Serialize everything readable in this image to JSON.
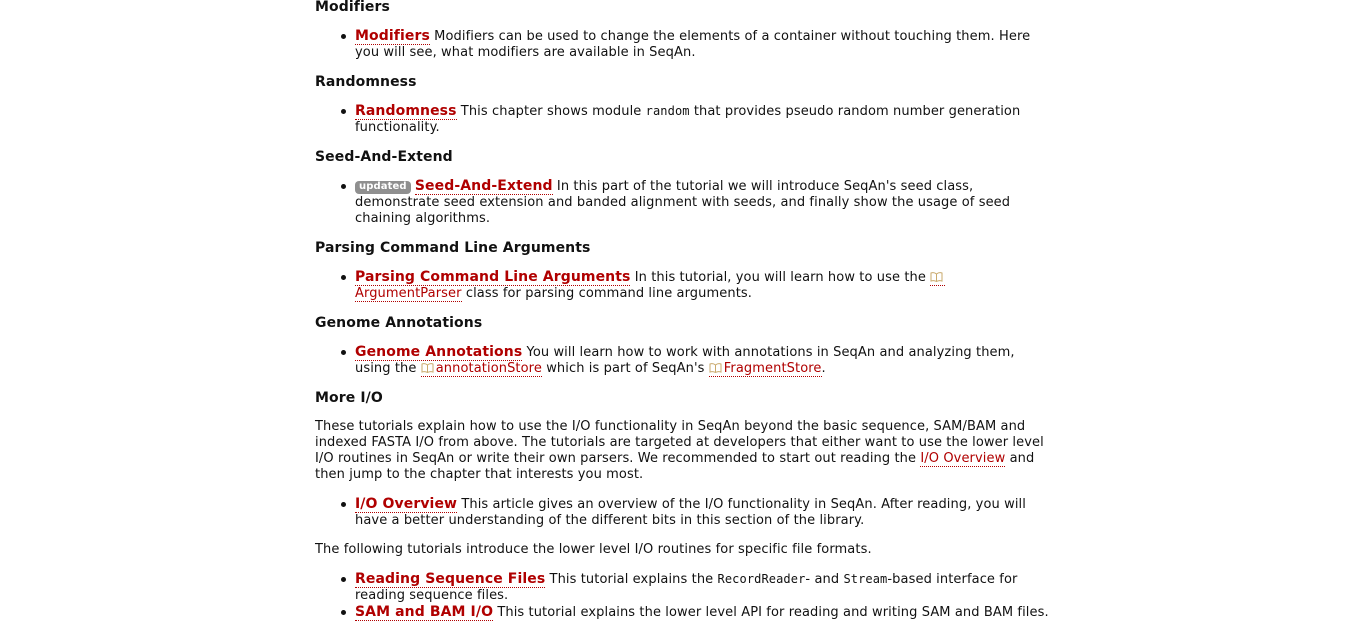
{
  "sections": {
    "modifiers": {
      "heading": "Modifiers",
      "link": "Modifiers",
      "text": "Modifiers can be used to change the elements of a container without touching them. Here you will see, what modifiers are available in SeqAn."
    },
    "randomness": {
      "heading": "Randomness",
      "link": "Randomness",
      "text_before": "This chapter shows module",
      "code": "random",
      "text_after": "that provides pseudo random number generation functionality."
    },
    "seed_and_extend": {
      "heading": "Seed-And-Extend",
      "badge": "updated",
      "link": "Seed-And-Extend",
      "text": "In this part of the tutorial we will introduce SeqAn's seed class, demonstrate seed extension and banded alignment with seeds, and finally show the usage of seed chaining algorithms."
    },
    "parsing": {
      "heading": "Parsing Command Line Arguments",
      "link": "Parsing Command Line Arguments",
      "text_before": "In this tutorial, you will learn how to use the",
      "ref": "ArgumentParser",
      "text_after": "class for parsing command line arguments."
    },
    "genome": {
      "heading": "Genome Annotations",
      "link": "Genome Annotations",
      "text_before": "You will learn how to work with annotations in SeqAn and analyzing them, using the",
      "ref1": "annotationStore",
      "text_middle": "which is part of SeqAn's",
      "ref2": "FragmentStore",
      "text_after": "."
    },
    "more_io": {
      "heading": "More I/O",
      "intro_before": "These tutorials explain how to use the I/O functionality in SeqAn beyond the basic sequence, SAM/BAM and indexed FASTA I/O from above. The tutorials are targeted at developers that either want to use the lower level I/O routines in SeqAn or write their own parsers. We recommended to start out reading the",
      "intro_link": "I/O Overview",
      "intro_after": "and then jump to the chapter that interests you most.",
      "overview_link": "I/O Overview",
      "overview_text": "This article gives an overview of the I/O functionality in SeqAn. After reading, you will have a better understanding of the different bits in this section of the library.",
      "following": "The following tutorials introduce the lower level I/O routines for specific file formats.",
      "reading_link": "Reading Sequence Files",
      "reading_before": "This tutorial explains the",
      "reading_code1": "RecordReader",
      "reading_mid": "- and",
      "reading_code2": "Stream",
      "reading_after": "-based interface for reading sequence files.",
      "sam_link": "SAM and BAM I/O",
      "sam_text": "This tutorial explains the lower level API for reading and writing SAM and BAM files."
    }
  },
  "colors": {
    "link": "#b00000",
    "badge_bg": "#8f8f8f",
    "text": "#111111"
  },
  "icons": {
    "ref_icon": "book-icon"
  }
}
